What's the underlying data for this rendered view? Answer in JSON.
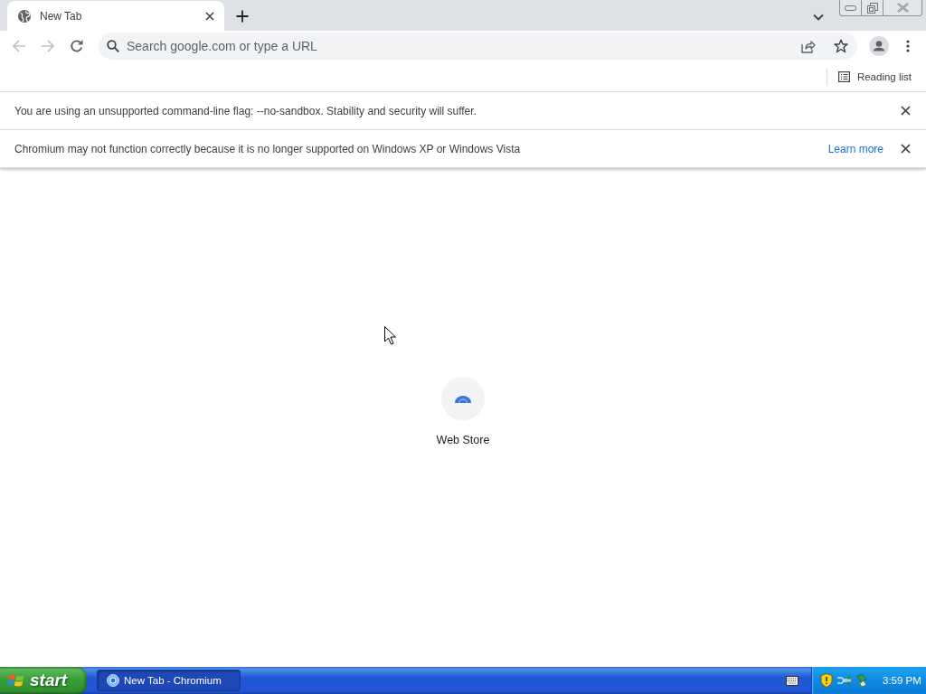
{
  "tabs": [
    {
      "title": "New Tab",
      "selected": true
    }
  ],
  "toolbar": {
    "back": {
      "disabled": true
    },
    "forward": {
      "disabled": true
    },
    "omnibox": {
      "placeholder": "Search google.com or type a URL"
    }
  },
  "bookmarks_bar": {
    "reading_list": "Reading list"
  },
  "infobars": [
    {
      "message": "You are using an unsupported command-line flag: --no-sandbox. Stability and security will suffer."
    },
    {
      "message": "Chromium may not function correctly because it is no longer supported on Windows XP or Windows Vista",
      "link": "Learn more"
    }
  ],
  "new_tab_page": {
    "shortcuts": [
      {
        "label": "Web Store"
      }
    ]
  },
  "taskbar": {
    "start": "start",
    "tasks": [
      {
        "label": "New Tab - Chromium",
        "selected": true
      }
    ],
    "clock": "3:59 PM"
  }
}
